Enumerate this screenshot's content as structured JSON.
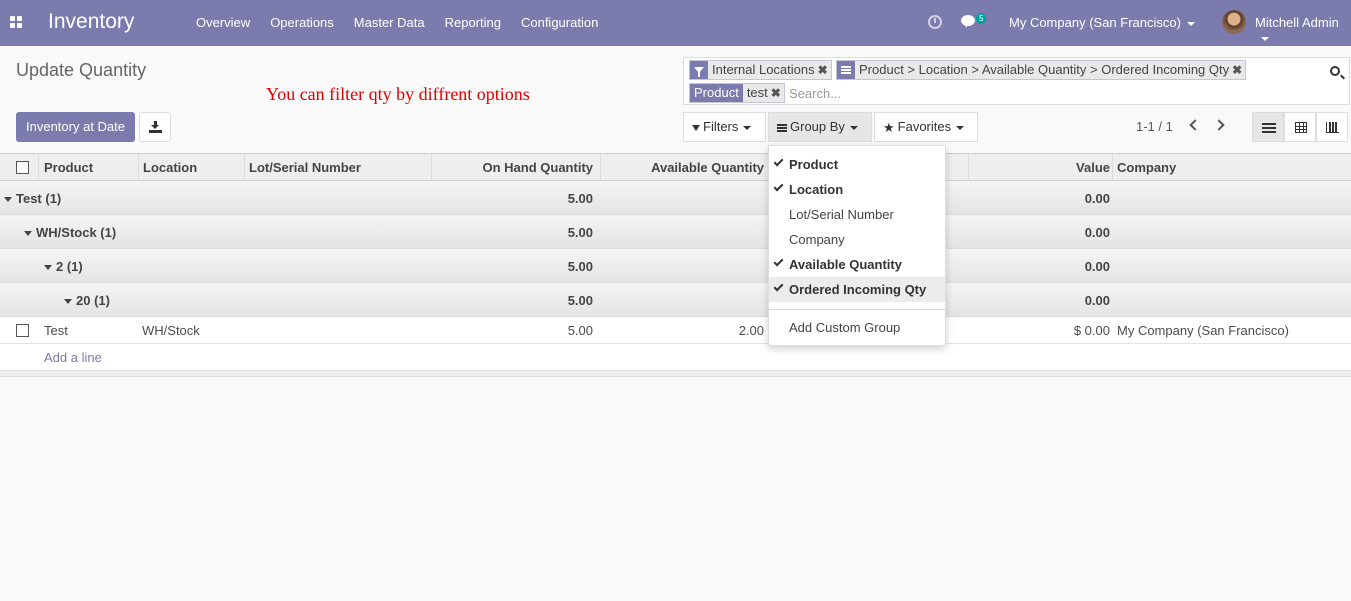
{
  "app": {
    "title": "Inventory"
  },
  "nav": {
    "items": [
      "Overview",
      "Operations",
      "Master Data",
      "Reporting",
      "Configuration"
    ]
  },
  "systray": {
    "messages_count": "5",
    "company": "My Company (San Francisco)",
    "user": "Mitchell Admin"
  },
  "page": {
    "title": "Update Quantity",
    "annotation": "You can filter qty by diffrent options"
  },
  "actions": {
    "primary": "Inventory at Date"
  },
  "search": {
    "facets": [
      {
        "values": "Internal Locations"
      },
      {
        "values": "Product > Location > Available Quantity > Ordered Incoming Qty"
      },
      {
        "label": "Product",
        "values": "test"
      }
    ],
    "placeholder": "Search..."
  },
  "filters": {
    "filters_label": "Filters",
    "groupby_label": "Group By",
    "favorites_label": "Favorites"
  },
  "pager": {
    "text": "1-1 / 1"
  },
  "table": {
    "columns": [
      "Product",
      "Location",
      "Lot/Serial Number",
      "On Hand Quantity",
      "Available Quantity",
      "Value",
      "Company"
    ],
    "groups": [
      {
        "label": "Test (1)",
        "on_hand": "5.00",
        "value": "0.00"
      },
      {
        "label": "WH/Stock (1)",
        "on_hand": "5.00",
        "value": "0.00"
      },
      {
        "label": "2 (1)",
        "on_hand": "5.00",
        "value": "0.00"
      },
      {
        "label": "20 (1)",
        "on_hand": "5.00",
        "value": "0.00"
      }
    ],
    "row": {
      "product": "Test",
      "location": "WH/Stock",
      "on_hand": "5.00",
      "available": "2.00",
      "value": "$ 0.00",
      "company": "My Company (San Francisco)"
    },
    "add_line": "Add a line"
  },
  "groupby_menu": {
    "items": [
      {
        "label": "Product",
        "checked": true
      },
      {
        "label": "Location",
        "checked": true
      },
      {
        "label": "Lot/Serial Number",
        "checked": false
      },
      {
        "label": "Company",
        "checked": false
      },
      {
        "label": "Available Quantity",
        "checked": true
      },
      {
        "label": "Ordered Incoming Qty",
        "checked": true
      }
    ],
    "custom": "Add Custom Group"
  },
  "colors": {
    "brand": "#7c7bad",
    "annotation": "#e00000"
  }
}
